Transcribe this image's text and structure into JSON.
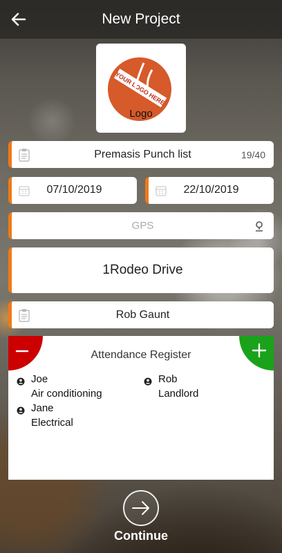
{
  "header": {
    "title": "New Project"
  },
  "logo": {
    "caption": "Logo",
    "badge_text": "YOUR LOGO HERE",
    "accent_color": "#d65a2a"
  },
  "form": {
    "project_name": {
      "value": "Premasis Punch list",
      "counter": "19/40"
    },
    "start_date": "07/10/2019",
    "end_date": "22/10/2019",
    "gps": {
      "placeholder": "GPS"
    },
    "address": "1Rodeo Drive",
    "manager": "Rob Gaunt",
    "accent_color": "#ef7a18"
  },
  "attendance": {
    "title": "Attendance Register",
    "remove_color": "#cc0000",
    "add_color": "#1aa21a",
    "people": [
      {
        "name": "Joe",
        "role": "Air conditioning"
      },
      {
        "name": "Rob",
        "role": "Landlord"
      },
      {
        "name": "Jane",
        "role": "Electrical"
      }
    ]
  },
  "footer": {
    "continue_label": "Continue"
  }
}
